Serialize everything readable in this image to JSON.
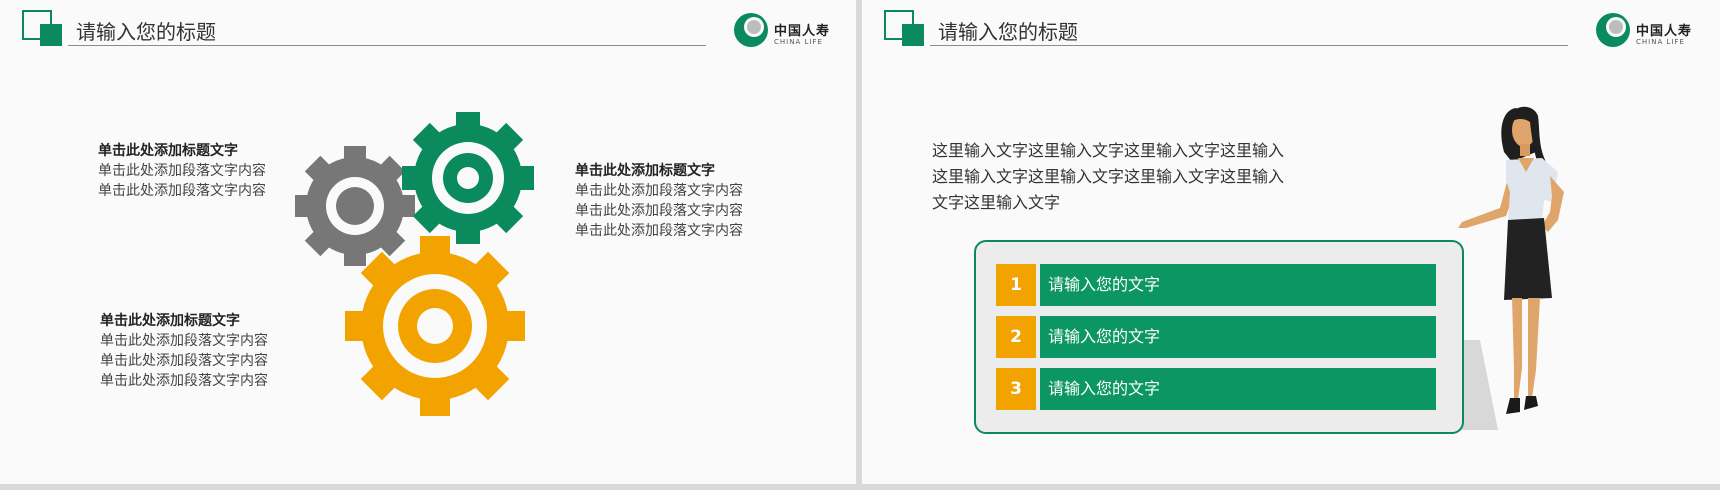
{
  "slides": [
    {
      "title": "请输入您的标题",
      "logo": {
        "name_cn": "中国人寿",
        "name_en": "CHINA LIFE"
      },
      "blocks": [
        {
          "heading": "单击此处添加标题文字",
          "lines": [
            "单击此处添加段落文字内容",
            "单击此处添加段落文字内容"
          ]
        },
        {
          "heading": "单击此处添加标题文字",
          "lines": [
            "单击此处添加段落文字内容",
            "单击此处添加段落文字内容",
            "单击此处添加段落文字内容"
          ]
        },
        {
          "heading": "单击此处添加标题文字",
          "lines": [
            "单击此处添加段落文字内容",
            "单击此处添加段落文字内容",
            "单击此处添加段落文字内容"
          ]
        }
      ]
    },
    {
      "title": "请输入您的标题",
      "logo": {
        "name_cn": "中国人寿",
        "name_en": "CHINA LIFE"
      },
      "paragraph": [
        "这里输入文字这里输入文字这里输入文字这里输入",
        "这里输入文字这里输入文字这里输入文字这里输入",
        "文字这里输入文字"
      ],
      "list": [
        {
          "num": "1",
          "text": "请输入您的文字"
        },
        {
          "num": "2",
          "text": "请输入您的文字"
        },
        {
          "num": "3",
          "text": "请输入您的文字"
        }
      ]
    }
  ],
  "colors": {
    "green": "#0b8a5d",
    "bar_green": "#0b9663",
    "orange": "#f2a300",
    "gray": "#777777"
  },
  "icons": [
    "gear-gray-icon",
    "gear-green-icon",
    "gear-orange-icon",
    "china-life-logo-icon",
    "presenter-woman-illustration"
  ]
}
